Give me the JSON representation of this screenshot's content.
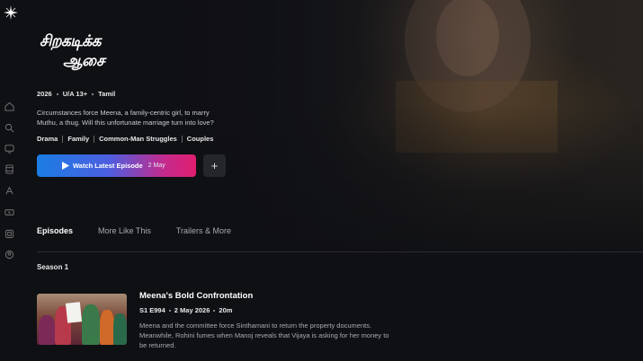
{
  "show": {
    "title_line1": "சிறகடிக்க",
    "title_line2": "ஆசை",
    "year": "2026",
    "rating": "U/A 13+",
    "language": "Tamil",
    "description": "Circumstances force Meena, a family-centric girl, to marry Muthu, a thug. Will this unfortunate marriage turn into love?",
    "genres": [
      "Drama",
      "Family",
      "Common-Man Struggles",
      "Couples"
    ]
  },
  "actions": {
    "watch_label": "Watch Latest Episode",
    "watch_date": "2 May",
    "add_label": "+"
  },
  "tabs": [
    {
      "label": "Episodes",
      "active": true
    },
    {
      "label": "More Like This",
      "active": false
    },
    {
      "label": "Trailers & More",
      "active": false
    }
  ],
  "season_label": "Season 1",
  "episode": {
    "title": "Meena's Bold Confrontation",
    "code": "S1 E994",
    "date": "2 May 2026",
    "duration": "20m",
    "description": "Meena and the committee force Sinthamani to return the property documents. Meanwhile, Rohini fumes when Manoj reveals that Vijaya is asking for her money to be returned."
  },
  "sidebar_icons": [
    "home-icon",
    "search-icon",
    "tv-icon",
    "movies-icon",
    "sports-icon",
    "sparks-icon",
    "categories-icon",
    "profile-icon"
  ],
  "colors": {
    "accent_start": "#1a7de3",
    "accent_end": "#e01e6f",
    "background": "#0f1014"
  }
}
